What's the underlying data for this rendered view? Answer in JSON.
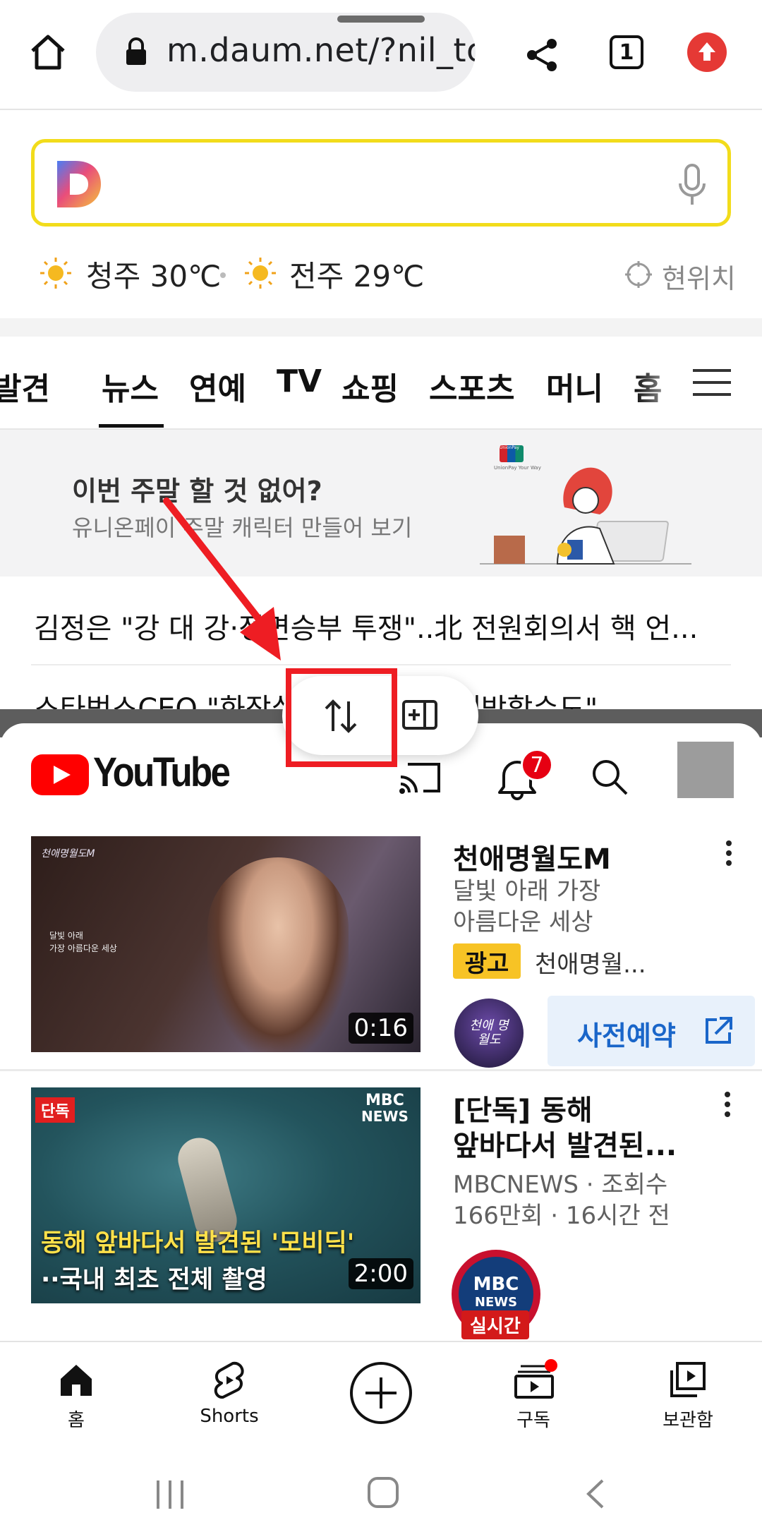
{
  "browser": {
    "url": "m.daum.net/?nil_tc",
    "tab_count": "1"
  },
  "daum": {
    "weather": [
      {
        "city_temp": "청주 30℃"
      },
      {
        "city_temp": "전주 29℃"
      }
    ],
    "location_label": "현위치",
    "tabs": [
      "발견",
      "뉴스",
      "연예",
      "TV",
      "쇼핑",
      "스포츠",
      "머니",
      "홈"
    ],
    "banner": {
      "title": "이번 주말 할 것 없어?",
      "subtitle": "유니온페이 주말 캐릭터 만들어 보기",
      "brand": "UnionPay",
      "brand_sub": "UnionPay Your Way"
    },
    "news": [
      "김정은 \"강 대 강·정면승부 투쟁\"..北 전원회의서 핵 언...",
      "스타벅스CEO \"화장실 ... 고객에만 개방할수도\""
    ]
  },
  "youtube": {
    "logo_text": "YouTube",
    "notification_count": "7",
    "videos": [
      {
        "title": "천애명월도M",
        "desc_line1": "달빛 아래 가장",
        "desc_line2": "아름다운 세상",
        "ad_badge": "광고",
        "advertiser": "천애명월...",
        "cta": "사전예약",
        "duration": "0:16",
        "thumb_logo": "천애명월도M",
        "thumb_caption1": "달빛 아래",
        "thumb_caption2": "가장 아름다운 세상",
        "channel_avatar_text": "천애 명월도"
      },
      {
        "title_line1": "[단독] 동해",
        "title_line2": "앞바다서 발견된...",
        "meta_line1": "MBCNEWS · 조회수",
        "meta_line2": "166만회 · 16시간 전",
        "duration": "2:00",
        "thumb_badge": "단독",
        "thumb_logo1": "MBC",
        "thumb_logo2": "NEWS",
        "thumb_headline1": "동해 앞바다서 발견된 '모비딕'",
        "thumb_headline2": "··국내 최초 전체 촬영",
        "avatar_text1": "MBC",
        "avatar_text2": "NEWS",
        "live_badge": "실시간"
      }
    ],
    "nav": [
      {
        "label": "홈"
      },
      {
        "label": "Shorts"
      },
      {
        "label": ""
      },
      {
        "label": "구독"
      },
      {
        "label": "보관함"
      }
    ]
  },
  "colors": {
    "youtube_red": "#ff0000",
    "annotation_red": "#ee1d23",
    "daum_search_border": "#f2dc1b",
    "ad_badge": "#f7c325",
    "cta_bg": "#e8f1fb",
    "cta_text": "#1a66c9"
  }
}
